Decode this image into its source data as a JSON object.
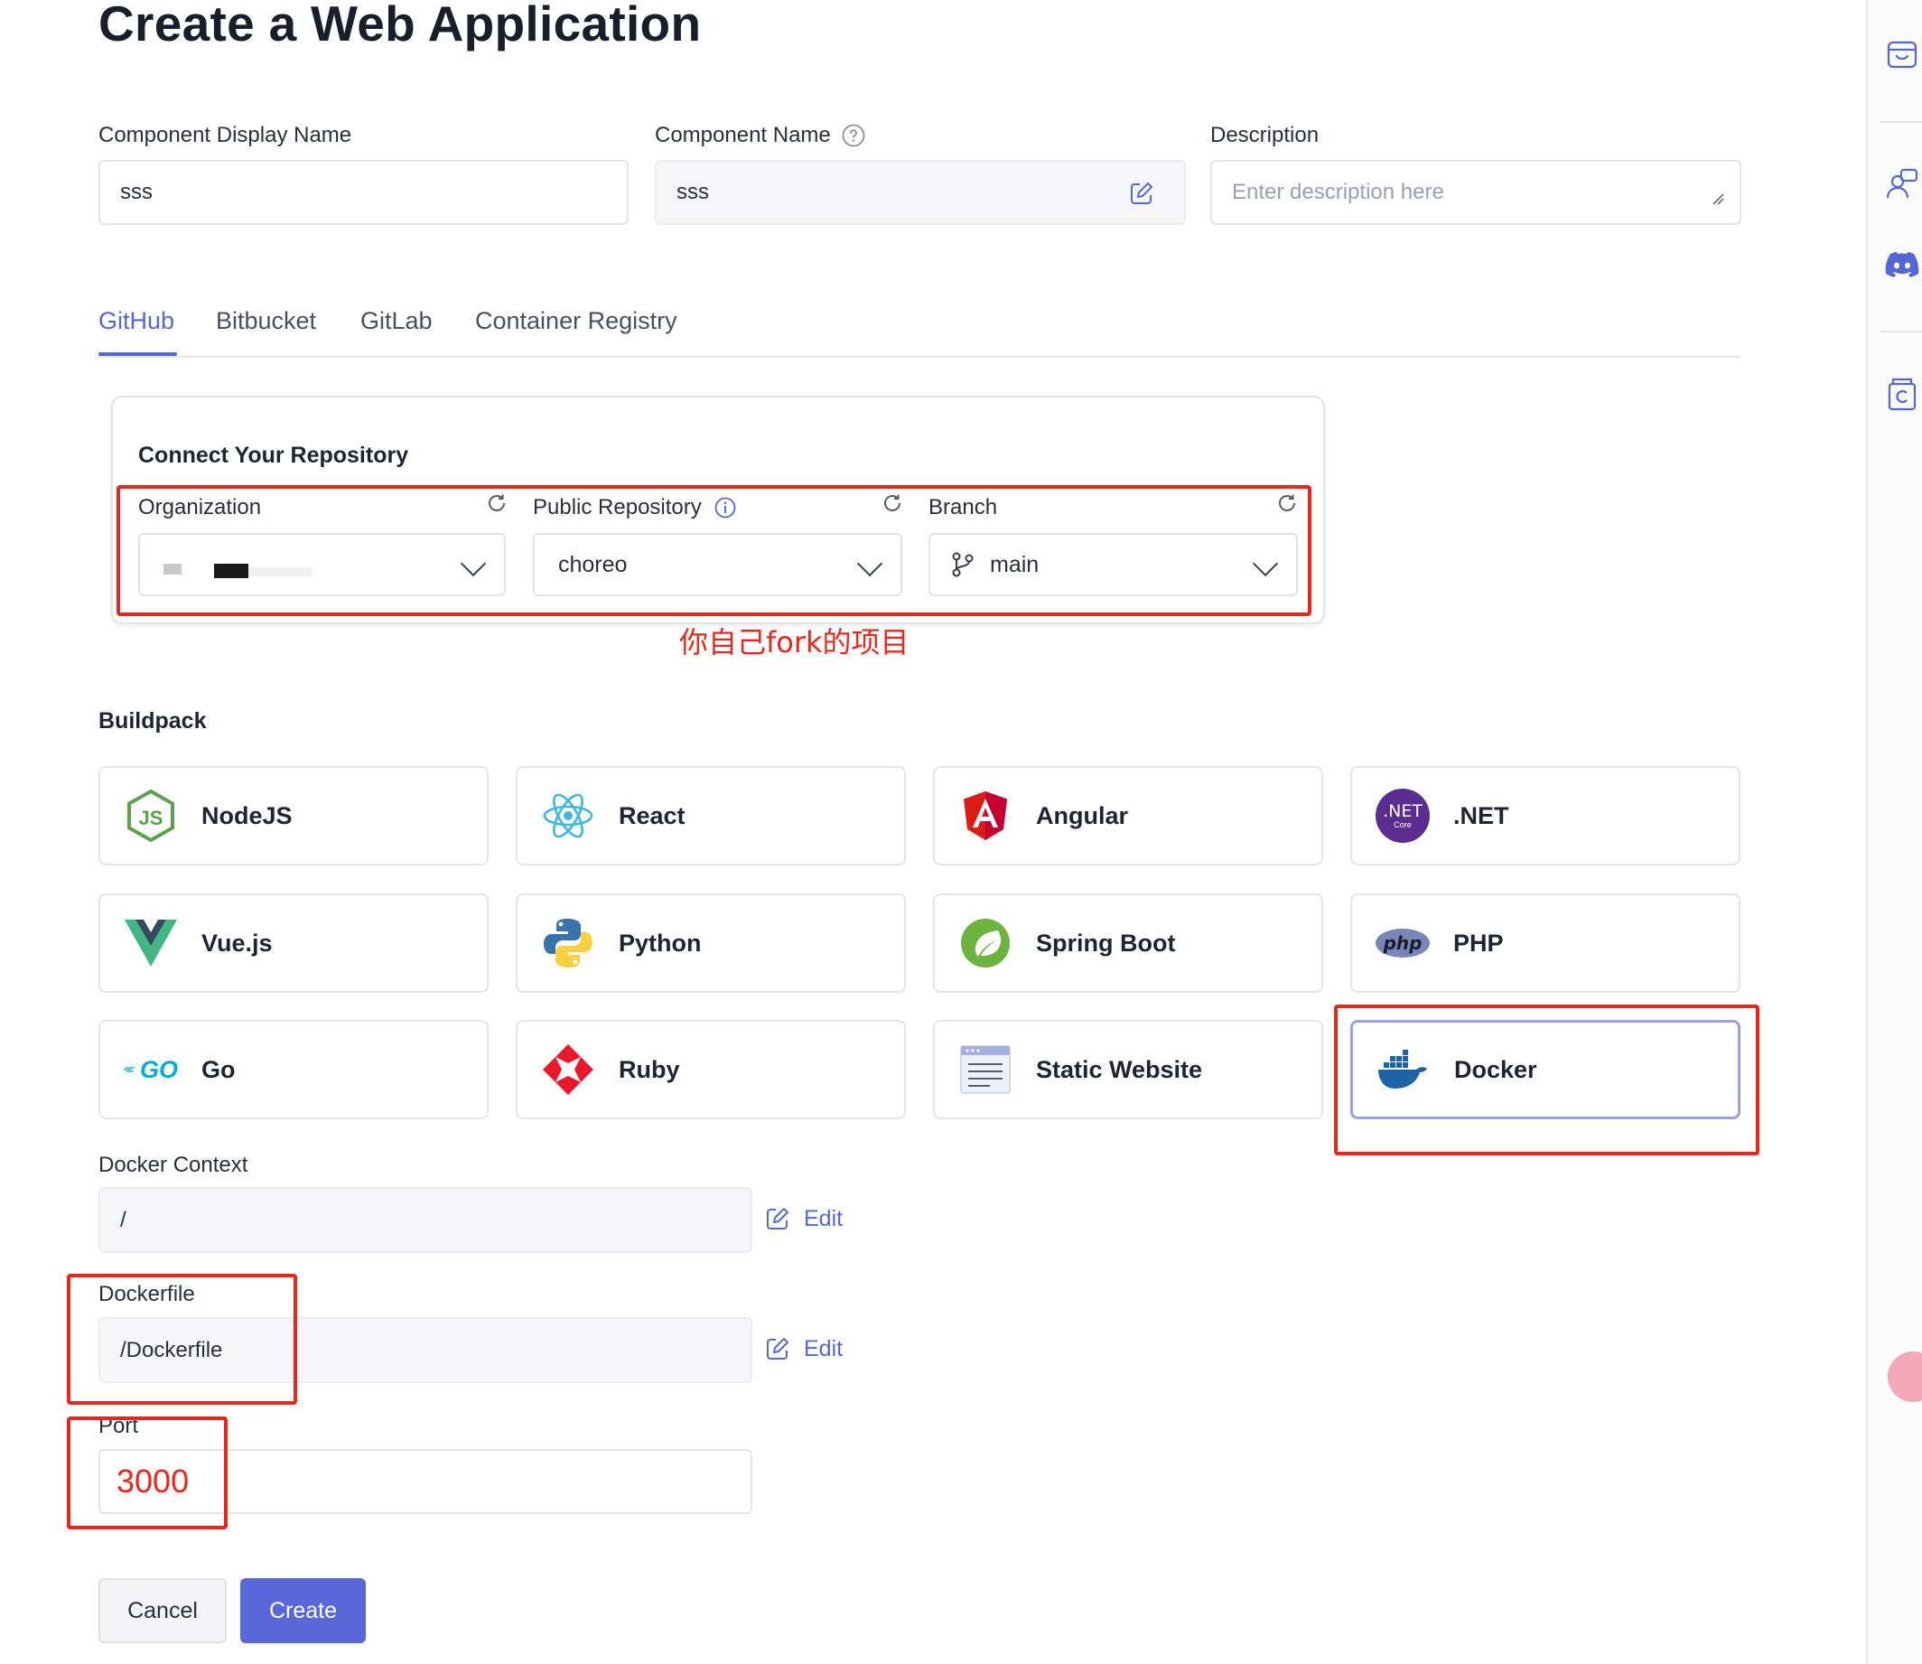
{
  "page": {
    "title": "Create a Web Application"
  },
  "form": {
    "display_name": {
      "label": "Component Display Name",
      "value": "sss"
    },
    "component_name": {
      "label": "Component Name",
      "value": "sss"
    },
    "description": {
      "label": "Description",
      "placeholder": "Enter description here"
    }
  },
  "tabs": [
    {
      "label": "GitHub",
      "active": true
    },
    {
      "label": "Bitbucket"
    },
    {
      "label": "GitLab"
    },
    {
      "label": "Container Registry"
    }
  ],
  "repo": {
    "heading": "Connect Your Repository",
    "organization": {
      "label": "Organization"
    },
    "repository": {
      "label": "Public Repository",
      "value": "choreo"
    },
    "branch": {
      "label": "Branch",
      "value": "main"
    },
    "annotation": "你自己fork的项目"
  },
  "buildpack": {
    "heading": "Buildpack",
    "items": [
      {
        "name": "NodeJS",
        "icon": "nodejs-icon"
      },
      {
        "name": "React",
        "icon": "react-icon"
      },
      {
        "name": "Angular",
        "icon": "angular-icon"
      },
      {
        "name": ".NET",
        "icon": "dotnet-icon",
        "icon_text": ".NET",
        "icon_sub": "Core"
      },
      {
        "name": "Vue.js",
        "icon": "vue-icon"
      },
      {
        "name": "Python",
        "icon": "python-icon"
      },
      {
        "name": "Spring Boot",
        "icon": "spring-icon"
      },
      {
        "name": "PHP",
        "icon": "php-icon",
        "icon_text": "php"
      },
      {
        "name": "Go",
        "icon": "go-icon",
        "icon_text": "GO"
      },
      {
        "name": "Ruby",
        "icon": "ruby-icon"
      },
      {
        "name": "Static Website",
        "icon": "static-website-icon"
      },
      {
        "name": "Docker",
        "icon": "docker-icon",
        "selected": true
      }
    ]
  },
  "docker": {
    "context": {
      "label": "Docker Context",
      "value": "/",
      "edit": "Edit"
    },
    "dockerfile": {
      "label": "Dockerfile",
      "value": "/Dockerfile",
      "edit": "Edit"
    },
    "port": {
      "label": "Port",
      "value": "3000"
    }
  },
  "actions": {
    "cancel": "Cancel",
    "create": "Create"
  },
  "colors": {
    "accent": "#5a67d8",
    "annotation_red": "#e8271c",
    "selected_border": "#98a1e6"
  }
}
